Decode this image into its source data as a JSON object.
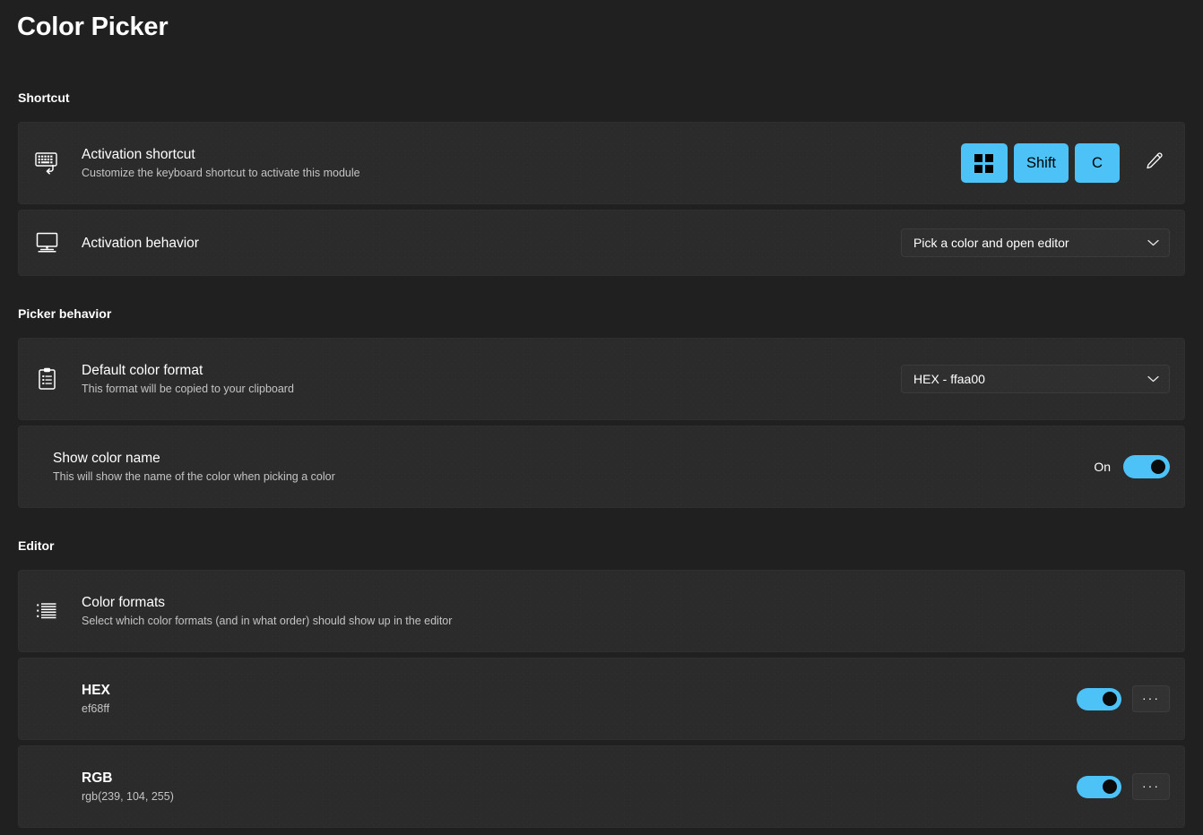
{
  "page": {
    "title": "Color Picker"
  },
  "sections": {
    "shortcut": {
      "heading": "Shortcut",
      "activation_shortcut": {
        "icon": "keyboard-shortcut-icon",
        "title": "Activation shortcut",
        "description": "Customize the keyboard shortcut to activate this module",
        "keys": [
          "⊞",
          "Shift",
          "C"
        ],
        "key_labels": {
          "win": "Windows key",
          "shift": "Shift",
          "c": "C"
        },
        "edit_icon": "pencil-icon",
        "key_color": "#4cc2f7"
      },
      "activation_behavior": {
        "icon": "monitor-icon",
        "title": "Activation behavior",
        "dropdown_value": "Pick a color and open editor",
        "chevron": "⌄"
      }
    },
    "picker_behavior": {
      "heading": "Picker behavior",
      "default_color_format": {
        "icon": "clipboard-icon",
        "title": "Default color format",
        "description": "This format will be copied to your clipboard",
        "dropdown_value": "HEX - ffaa00"
      },
      "show_color_name": {
        "title": "Show color name",
        "description": "This will show the name of the color when picking a color",
        "toggle_label": "On",
        "toggle_state": "on"
      }
    },
    "editor": {
      "heading": "Editor",
      "color_formats": {
        "icon": "list-icon",
        "title": "Color formats",
        "description": "Select which color formats (and in what order) should show up in the editor"
      },
      "formats": [
        {
          "name": "HEX",
          "sample": "ef68ff",
          "toggle_state": "on",
          "more_label": "···"
        },
        {
          "name": "RGB",
          "sample": "rgb(239, 104, 255)",
          "toggle_state": "on",
          "more_label": "···"
        }
      ]
    }
  },
  "colors": {
    "accent": "#4cc2f7",
    "page_bg": "#202020",
    "card_bg": "#2b2b2b"
  }
}
